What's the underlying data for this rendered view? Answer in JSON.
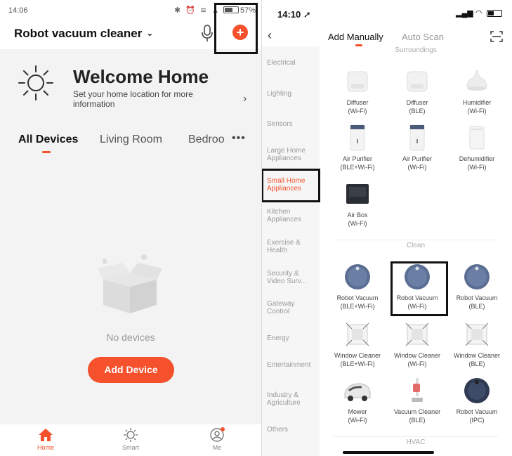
{
  "left": {
    "status": {
      "time": "14:06",
      "battery": "57%"
    },
    "header": {
      "title": "Robot vacuum cleaner"
    },
    "welcome": {
      "title": "Welcome Home",
      "subtitle": "Set your home location for more information"
    },
    "tabs": [
      {
        "label": "All Devices"
      },
      {
        "label": "Living Room"
      },
      {
        "label": "Bedroo"
      }
    ],
    "tabs_more": "•••",
    "empty_text": "No devices",
    "add_device_label": "Add Device",
    "bottom_nav": [
      {
        "label": "Home"
      },
      {
        "label": "Smart"
      },
      {
        "label": "Me"
      }
    ],
    "accent": "#f4512c"
  },
  "right": {
    "status": {
      "time": "14:10"
    },
    "tabs": {
      "manual": "Add Manually",
      "auto": "Auto Scan"
    },
    "categories": [
      "Electrical",
      "Lighting",
      "Sensors",
      "Large Home Appliances",
      "Small Home Appliances",
      "Kitchen Appliances",
      "Exercise & Health",
      "Security & Video Surv...",
      "Gateway Control",
      "Energy",
      "Entertainment",
      "Industry & Agriculture",
      "Others"
    ],
    "sections": {
      "top": "Surroundings",
      "clean": "Clean",
      "hvac": "HVAC"
    },
    "devices": [
      {
        "name": "Diffuser",
        "conn": "(Wi-Fi)",
        "icon": "diffuser-icon"
      },
      {
        "name": "Diffuser",
        "conn": "(BLE)",
        "icon": "diffuser-icon"
      },
      {
        "name": "Humidifier",
        "conn": "(Wi-Fi)",
        "icon": "humidifier-icon"
      },
      {
        "name": "Air Purifier",
        "conn": "(BLE+Wi-Fi)",
        "icon": "air-purifier-icon"
      },
      {
        "name": "Air Purifier",
        "conn": "(Wi-Fi)",
        "icon": "air-purifier-icon"
      },
      {
        "name": "Dehumidifier",
        "conn": "(Wi-Fi)",
        "icon": "dehumidifier-icon"
      },
      {
        "name": "Air Box",
        "conn": "(Wi-Fi)",
        "icon": "air-box-icon"
      },
      {
        "name": "Robot Vacuum",
        "conn": "(BLE+Wi-Fi)",
        "icon": "robot-vacuum-icon"
      },
      {
        "name": "Robot Vacuum",
        "conn": "(Wi-Fi)",
        "icon": "robot-vacuum-icon"
      },
      {
        "name": "Robot Vacuum",
        "conn": "(BLE)",
        "icon": "robot-vacuum-icon"
      },
      {
        "name": "Window Cleaner",
        "conn": "(BLE+Wi-Fi)",
        "icon": "window-cleaner-icon"
      },
      {
        "name": "Window Cleaner",
        "conn": "(Wi-Fi)",
        "icon": "window-cleaner-icon"
      },
      {
        "name": "Window Cleaner",
        "conn": "(BLE)",
        "icon": "window-cleaner-icon"
      },
      {
        "name": "Mower",
        "conn": "(Wi-Fi)",
        "icon": "mower-icon"
      },
      {
        "name": "Vacuum Cleaner",
        "conn": "(BLE)",
        "icon": "vacuum-cleaner-icon"
      },
      {
        "name": "Robot Vacuum",
        "conn": "(IPC)",
        "icon": "robot-vacuum-icon"
      }
    ]
  }
}
